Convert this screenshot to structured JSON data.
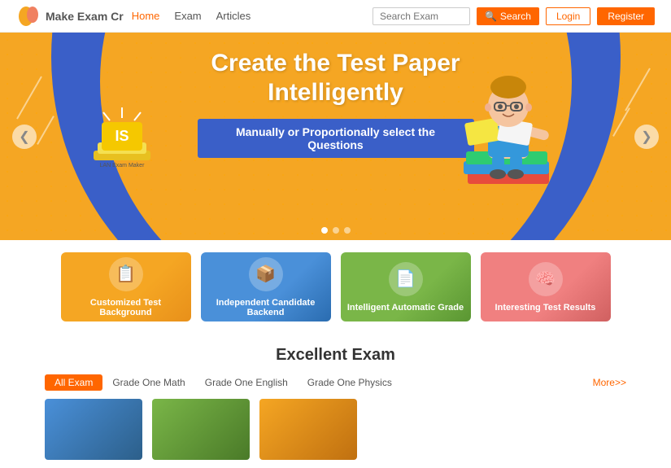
{
  "navbar": {
    "site_name": "Make Exam Cr",
    "nav_items": [
      {
        "label": "Home",
        "active": true
      },
      {
        "label": "Exam",
        "active": false
      },
      {
        "label": "Articles",
        "active": false
      }
    ],
    "search_placeholder": "Search Exam",
    "search_btn_label": "Search",
    "login_label": "Login",
    "register_label": "Register"
  },
  "hero": {
    "title_line1": "Create the Test Paper",
    "title_line2": "Intelligently",
    "subtitle": "Manually or Proportionally select the Questions",
    "prev_arrow": "❮",
    "next_arrow": "❯"
  },
  "features": [
    {
      "label": "Customized Test Background",
      "color": "card-orange",
      "icon": "📋"
    },
    {
      "label": "Independent Candidate Backend",
      "color": "card-blue",
      "icon": "📦"
    },
    {
      "label": "Intelligent Automatic Grade",
      "color": "card-green",
      "icon": "📄"
    },
    {
      "label": "Interesting Test Results",
      "color": "card-pink",
      "icon": "🧠"
    }
  ],
  "excellent": {
    "title": "Excellent Exam",
    "tabs": [
      {
        "label": "All Exam",
        "active": true
      },
      {
        "label": "Grade One Math",
        "active": false
      },
      {
        "label": "Grade One English",
        "active": false
      },
      {
        "label": "Grade One Physics",
        "active": false
      }
    ],
    "more_label": "More>>"
  }
}
